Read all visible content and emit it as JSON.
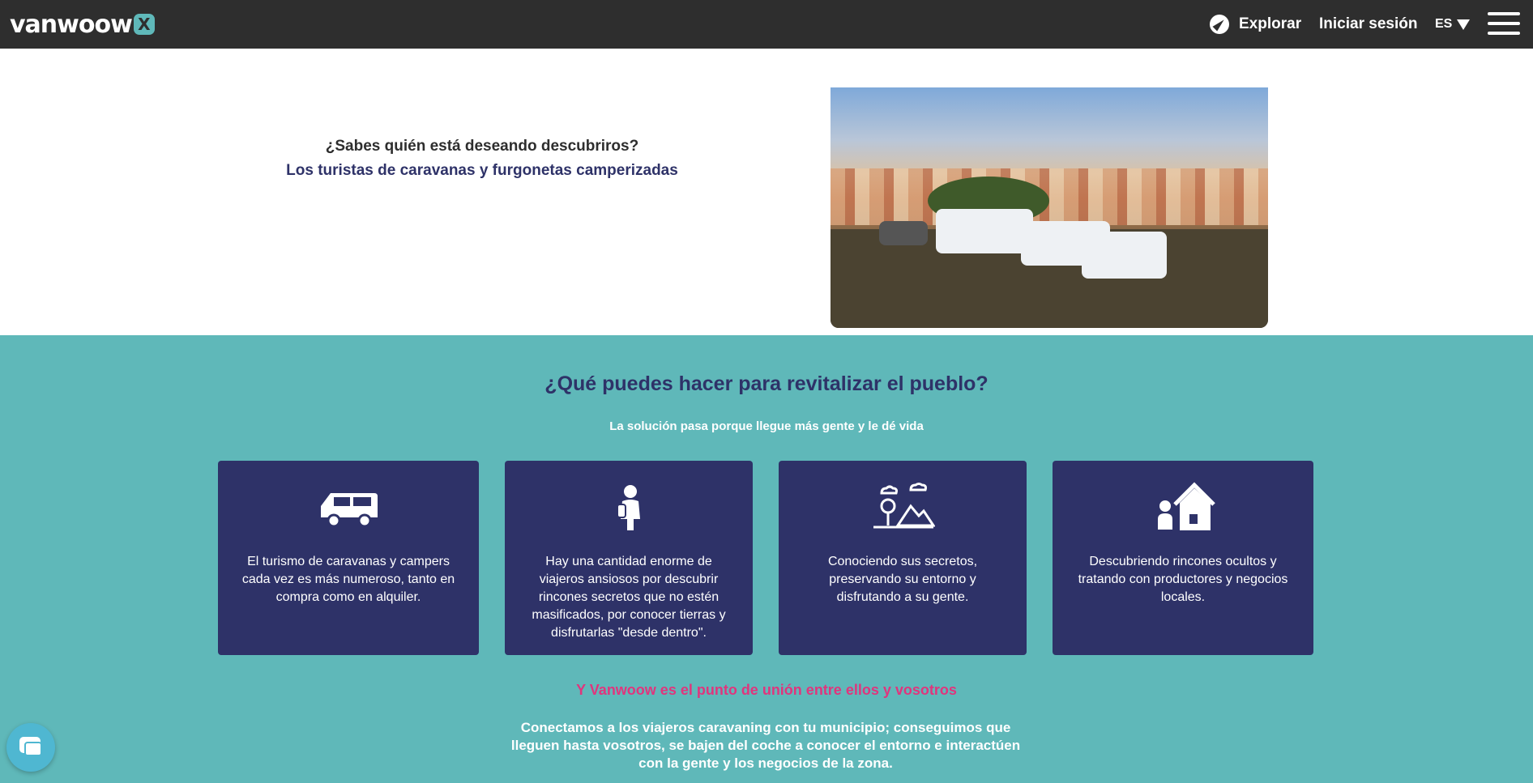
{
  "header": {
    "logo_text": "vanwoow",
    "logo_badge": "X",
    "explore_label": "Explorar",
    "login_label": "Iniciar sesión",
    "lang_label": "ES",
    "colors": {
      "bar": "#2e2e2e",
      "brand_teal": "#5fb8b9"
    }
  },
  "intro": {
    "question": "¿Sabes quién está deseando descubriros?",
    "answer": "Los turistas de caravanas y furgonetas camperizadas"
  },
  "revitalize": {
    "title": "¿Qué puedes hacer para revitalizar el pueblo?",
    "subtitle": "La solución pasa porque llegue más gente y le dé vida",
    "cards": [
      {
        "icon": "camper-van-icon",
        "text": "El turismo de caravanas y campers cada vez es más numeroso, tanto en compra como en alquiler."
      },
      {
        "icon": "traveler-icon",
        "text": "Hay una cantidad enorme de viajeros ansiosos por descubrir rincones secretos que no estén masificados, por conocer tierras y disfrutarlas \"desde dentro\"."
      },
      {
        "icon": "landscape-icon",
        "text": "Conociendo sus secretos, preservando su entorno y disfrutando a su gente."
      },
      {
        "icon": "person-house-icon",
        "text": "Descubriendo rincones ocultos y tratando con productores y negocios locales."
      }
    ],
    "highlight": "Y Vanwoow es el punto de unión entre ellos y vosotros",
    "closing": "Conectamos a los viajeros caravaning con tu municipio; conseguimos que lleguen hasta vosotros, se bajen del coche a conocer el entorno e interactúen con la gente y los negocios de la zona.",
    "colors": {
      "background": "#5fb8b9",
      "card": "#2e3268",
      "highlight": "#e0357d"
    }
  },
  "chat_widget": {
    "icon": "chat-bubbles-icon"
  }
}
